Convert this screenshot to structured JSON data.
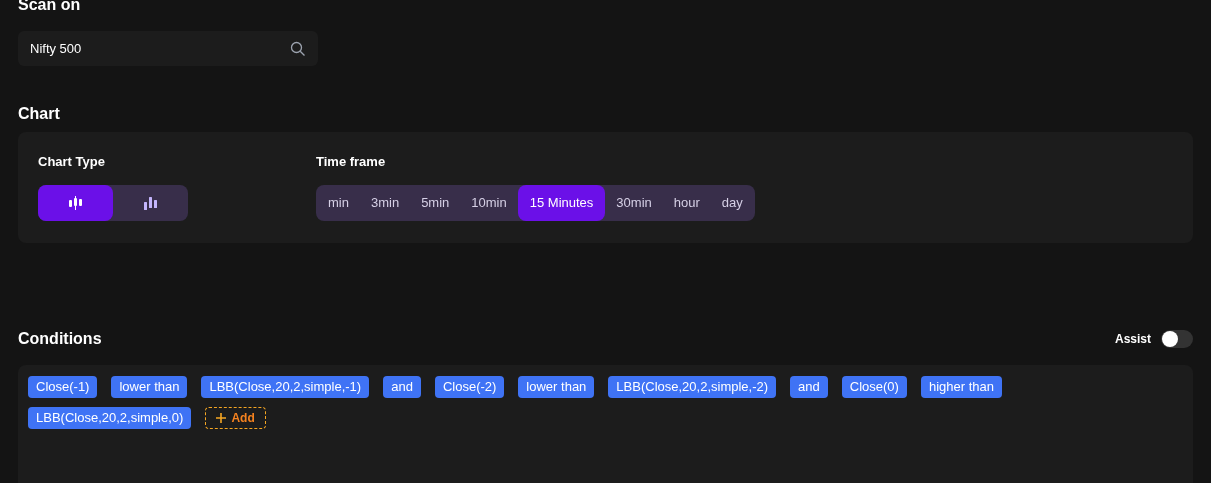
{
  "scan_on": {
    "title": "Scan on",
    "value": "Nifty 500"
  },
  "chart": {
    "title": "Chart",
    "chart_type_label": "Chart Type",
    "chart_types": [
      {
        "kind": "candles",
        "selected": true
      },
      {
        "kind": "bars",
        "selected": false
      }
    ],
    "time_frame_label": "Time frame",
    "time_frames": [
      {
        "label": "min",
        "selected": false
      },
      {
        "label": "3min",
        "selected": false
      },
      {
        "label": "5min",
        "selected": false
      },
      {
        "label": "10min",
        "selected": false
      },
      {
        "label": "15 Minutes",
        "selected": true
      },
      {
        "label": "30min",
        "selected": false
      },
      {
        "label": "hour",
        "selected": false
      },
      {
        "label": "day",
        "selected": false
      }
    ]
  },
  "conditions": {
    "title": "Conditions",
    "assist": {
      "label": "Assist",
      "on": false
    },
    "tokens": [
      "Close(-1)",
      "lower than",
      "LBB(Close,20,2,simple,-1)",
      "and",
      "Close(-2)",
      "lower than",
      "LBB(Close,20,2,simple,-2)",
      "and",
      "Close(0)",
      "higher than",
      "LBB(Close,20,2,simple,0)"
    ],
    "add_label": "Add"
  }
}
